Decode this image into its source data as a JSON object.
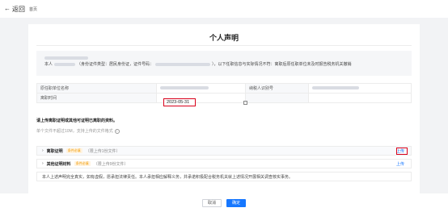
{
  "topbar": {
    "back_label": "返回",
    "breadcrumb": "首页"
  },
  "document": {
    "title": "个人声明"
  },
  "declaration": {
    "prefix": "本人",
    "id_type_text": "（身份证件类型：居民身份证，证件号码：",
    "statement_text": "），以下任职信息与实际情况不符：离职后原任职单位未及时报告税务机关撤销"
  },
  "info_table": {
    "employer_label": "原任职单位名称",
    "taxpayer_id_label": "纳税人识别号",
    "leave_date_label": "离职时间",
    "leave_date_value": "2023-05-31"
  },
  "upload": {
    "title": "请上传离职证明或其他可证明已离职的资料。",
    "hint": "单个文件不超过10M，支持上传的文件格式",
    "files": [
      {
        "name": "离职证明",
        "tag": "条件必填",
        "limit": "（限上传1份文件）",
        "action": "上传"
      },
      {
        "name": "其他证明材料",
        "tag": "条件必填",
        "limit": "（限上传9份文件）",
        "action": "上传"
      }
    ]
  },
  "promise_text": "本人上述声明完全真实，如有虚假，愿承担法律责任。本人承担相应解释义务，并承诺积极配合税务机关就上述情况开展相关调查核实事务。",
  "footer": {
    "cancel_label": "取消",
    "confirm_label": "确定"
  },
  "colors": {
    "accent": "#1677ff",
    "highlight_red": "#d9001b",
    "tag_orange": "#f29b00"
  }
}
